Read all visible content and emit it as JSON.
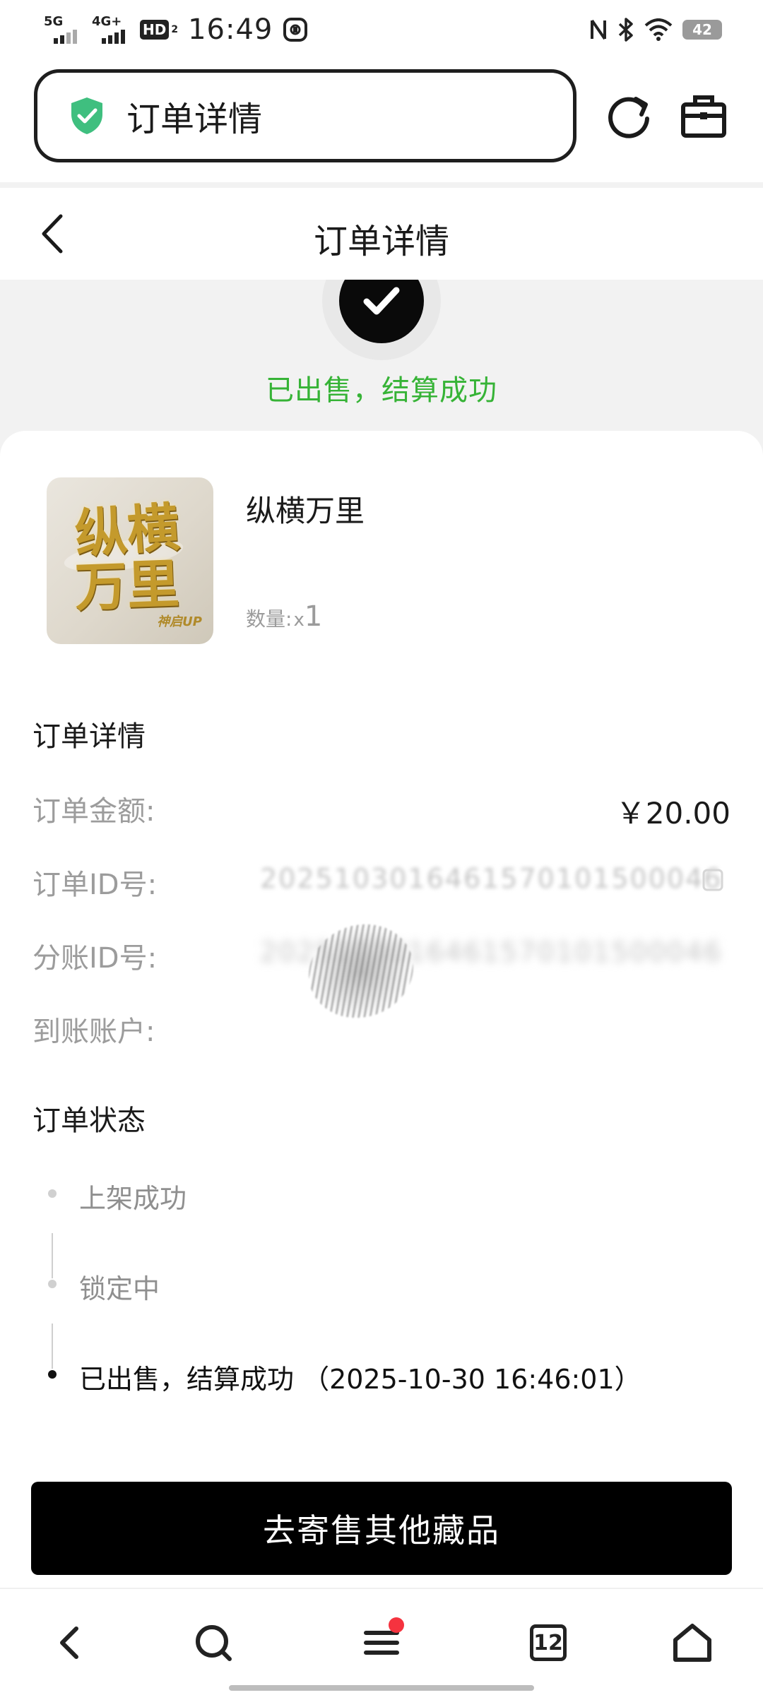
{
  "status_bar": {
    "time": "16:49",
    "signal1_tag": "5G",
    "signal2_tag": "4G+",
    "hd_label": "HD",
    "hd_sub": "2",
    "battery": "42"
  },
  "browser": {
    "url_title": "订单详情",
    "tab_count": "12"
  },
  "header": {
    "title": "订单详情"
  },
  "banner": {
    "status_text": "已出售，结算成功"
  },
  "product": {
    "name": "纵横万里",
    "thumb_line1": "纵横",
    "thumb_line2": "万里",
    "thumb_sign": "神启UP",
    "qty_label": "数量:",
    "qty_x": "x",
    "qty_value": "1"
  },
  "details": {
    "section_title": "订单详情",
    "amount_label": "订单金额:",
    "amount_value": "￥20.00",
    "order_id_label": "订单ID号:",
    "order_id_value": "2025103016461570101500046",
    "split_id_label": "分账ID号:",
    "split_id_value": "2025103016461570101500046",
    "account_label": "到账账户:"
  },
  "order_status": {
    "section_title": "订单状态",
    "steps": [
      {
        "label": "上架成功",
        "active": false
      },
      {
        "label": "锁定中",
        "active": false
      },
      {
        "label": "已出售，结算成功 （2025-10-30 16:46:01）",
        "active": true
      }
    ]
  },
  "cta": {
    "label": "去寄售其他藏品"
  },
  "colors": {
    "success_green": "#36b336",
    "shield_green": "#3fbf7f",
    "notification_red": "#f5333f"
  }
}
